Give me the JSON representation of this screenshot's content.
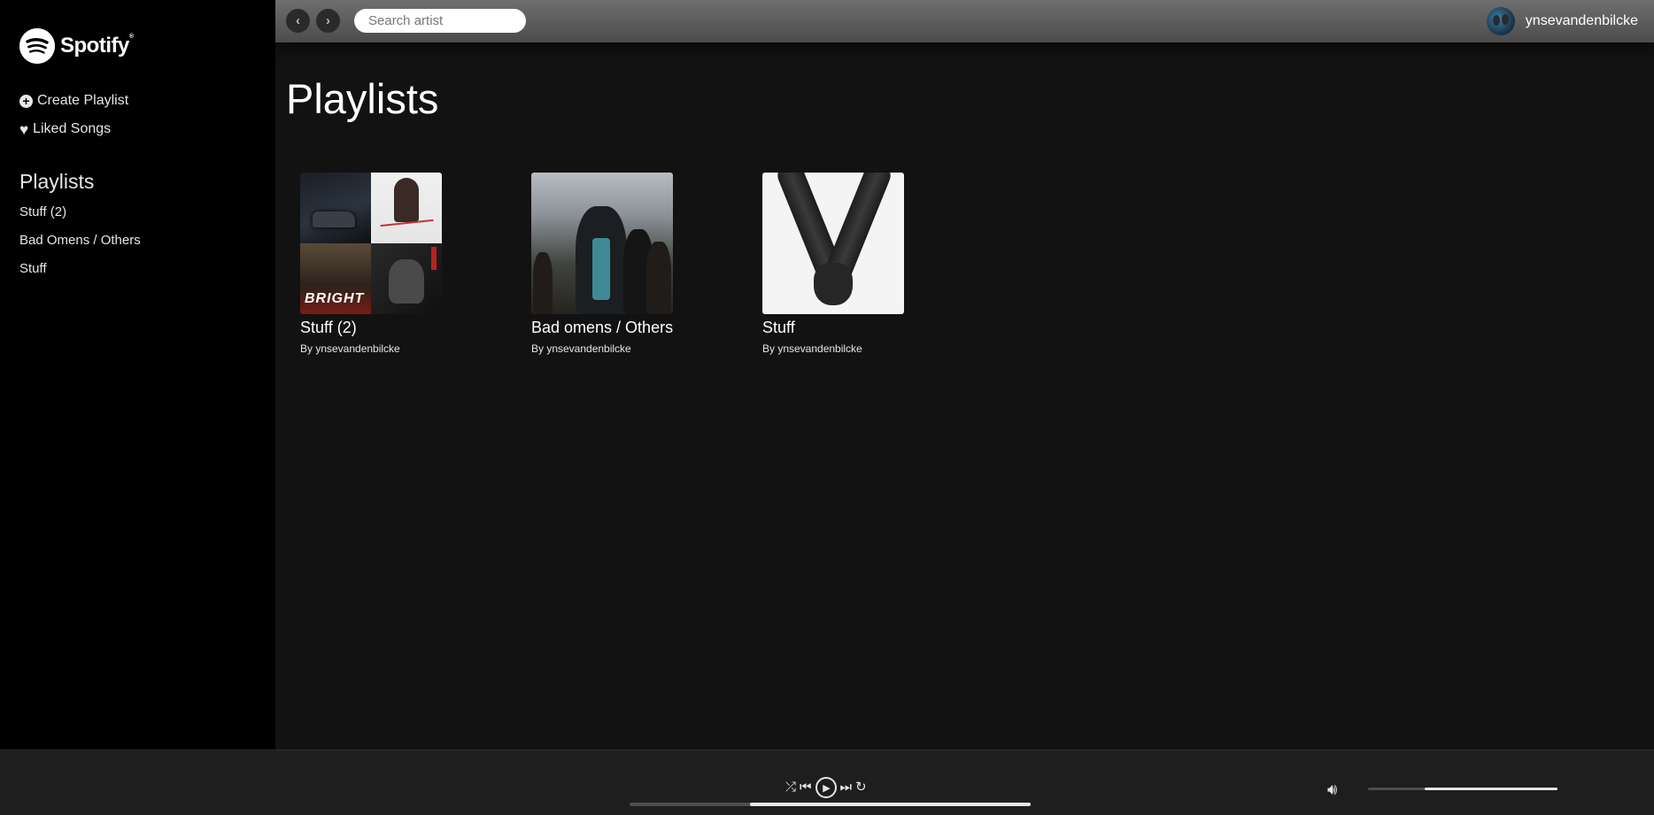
{
  "sidebar": {
    "logo_text": "Spotify",
    "logo_tm": "®",
    "create_playlist_label": "Create Playlist",
    "liked_songs_label": "Liked Songs",
    "playlists_heading": "Playlists",
    "playlists": [
      "Stuff (2)",
      "Bad Omens / Others",
      "Stuff"
    ]
  },
  "topbar": {
    "back_icon": "chevron-left-icon",
    "forward_icon": "chevron-right-icon",
    "search_placeholder": "Search artist",
    "username": "ynsevandenbilcke"
  },
  "main": {
    "title": "Playlists",
    "cards": [
      {
        "title": "Stuff (2)",
        "owner": "By ynsevandenbilcke",
        "cover": "mosaic",
        "tile_text": "BRIGHT"
      },
      {
        "title": "Bad omens / Others",
        "owner": "By ynsevandenbilcke",
        "cover": "band-photo"
      },
      {
        "title": "Stuff",
        "owner": "By ynsevandenbilcke",
        "cover": "hands-art"
      }
    ]
  },
  "player": {
    "icons": [
      "shuffle-icon",
      "previous-icon",
      "play-icon",
      "next-icon",
      "repeat-icon",
      "volume-icon"
    ],
    "progress_fraction": 0.3,
    "progress_fill_fraction": 0.7,
    "volume_level": 0.7
  },
  "colors": {
    "sidebar_bg": "#000000",
    "main_bg": "#121212",
    "player_bg": "#1e1e1e",
    "text": "#ffffff"
  }
}
